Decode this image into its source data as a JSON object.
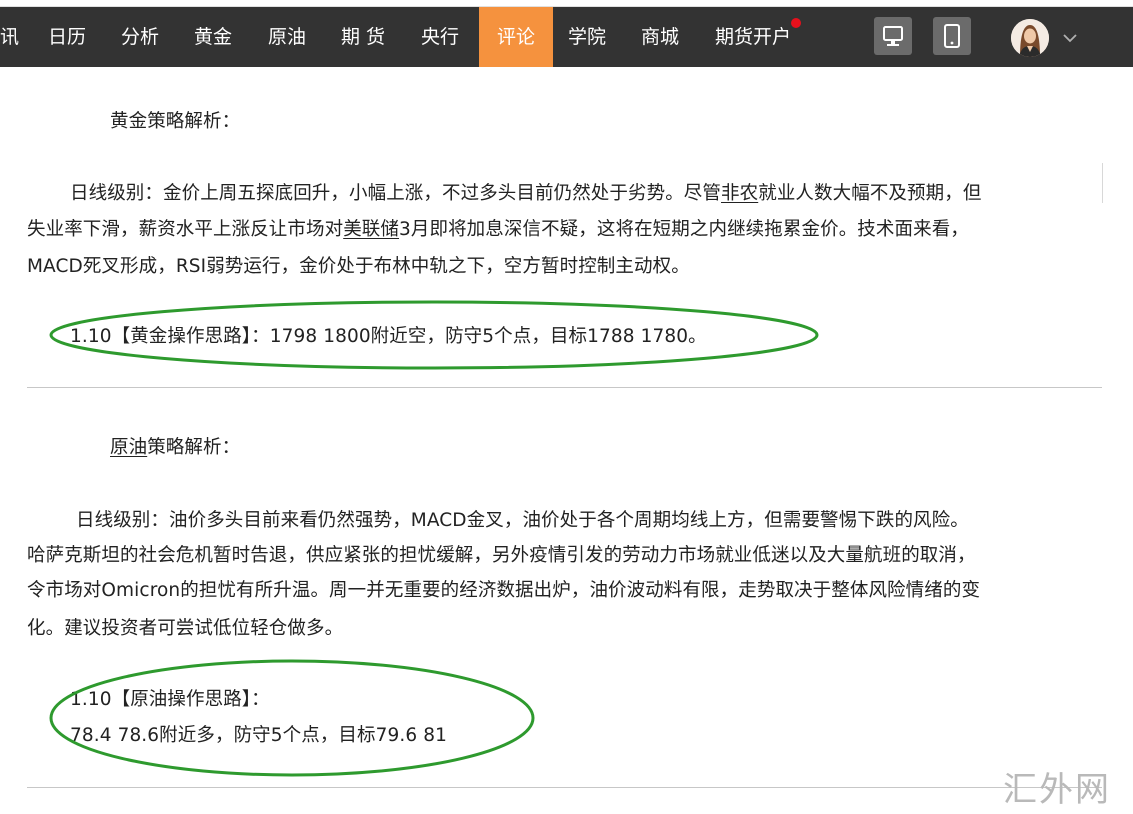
{
  "nav": {
    "items": [
      {
        "label": "讯"
      },
      {
        "label": "日历"
      },
      {
        "label": "分析"
      },
      {
        "label": "黄金"
      },
      {
        "label": "原油"
      },
      {
        "label": "期 货"
      },
      {
        "label": "央行"
      },
      {
        "label": "评论",
        "active": true
      },
      {
        "label": "学院"
      },
      {
        "label": "商城"
      },
      {
        "label": "期货开户",
        "badge": "red-dot"
      }
    ],
    "icons": {
      "desktop": "desktop-icon",
      "mobile": "mobile-icon",
      "avatar": "avatar",
      "dropdown": "chevron-down-icon"
    },
    "colors": {
      "bar": "#333333",
      "active": "#f5923e",
      "badge": "#e8101c"
    }
  },
  "gold": {
    "heading": "黄金策略解析：",
    "p1_a": "日线级别：金价上周五探底回升，小幅上涨，不过多头目前仍然处于劣势。尽管",
    "p1_link1": "非农",
    "p1_b": "就业人数大幅不及预期，但",
    "p2_a": "失业率下滑，薪资水平上涨反让市场对",
    "p2_link": "美联储",
    "p2_b": "3月即将加息深信不疑，这将在短期之内继续拖累金价。技术面来看，",
    "p3": "MACD死叉形成，RSI弱势运行，金价处于布林中轨之下，空方暂时控制主动权。",
    "plan": "1.10【黄金操作思路】：1798  1800附近空，防守5个点，目标1788  1780。"
  },
  "oil": {
    "heading_link": "原油",
    "heading_rest": "策略解析：",
    "p1": "日线级别：油价多头目前来看仍然强势，MACD金叉，油价处于各个周期均线上方，但需要警惕下跌的风险。",
    "p2": "哈萨克斯坦的社会危机暂时告退，供应紧张的担忧缓解，另外疫情引发的劳动力市场就业低迷以及大量航班的取消，",
    "p3": "令市场对Omicron的担忧有所升温。周一并无重要的经济数据出炉，油价波动料有限，走势取决于整体风险情绪的变",
    "p4": "化。建议投资者可尝试低位轻仓做多。",
    "plan_title": "1.10【原油操作思路】：",
    "plan_body": "78.4   78.6附近多，防守5个点，目标79.6  81"
  },
  "annotations": {
    "ellipse_color": "#2e9a2e"
  },
  "watermark": "汇外网"
}
